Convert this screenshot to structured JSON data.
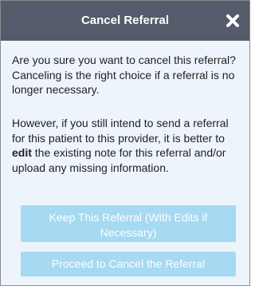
{
  "dialog": {
    "title": "Cancel Referral",
    "close_icon": "close-icon",
    "paragraph1": "Are you sure you want to cancel this referral? Canceling is the right choice if a referral is no longer necessary.",
    "paragraph2_before": "However, if you still intend to send a referral for this patient to this provider, it is better to ",
    "paragraph2_bold": "edit",
    "paragraph2_after": " the existing note for this referral and/or upload any missing information.",
    "keep_button_label": "Keep This Referral (With Edits if Necessary)",
    "cancel_button_label": "Proceed to Cancel the Referral"
  },
  "colors": {
    "header_bg": "#545c6b",
    "dialog_bg": "#eef4fb",
    "button_bg": "#a6d9f2",
    "button_text": "#ffffff"
  }
}
